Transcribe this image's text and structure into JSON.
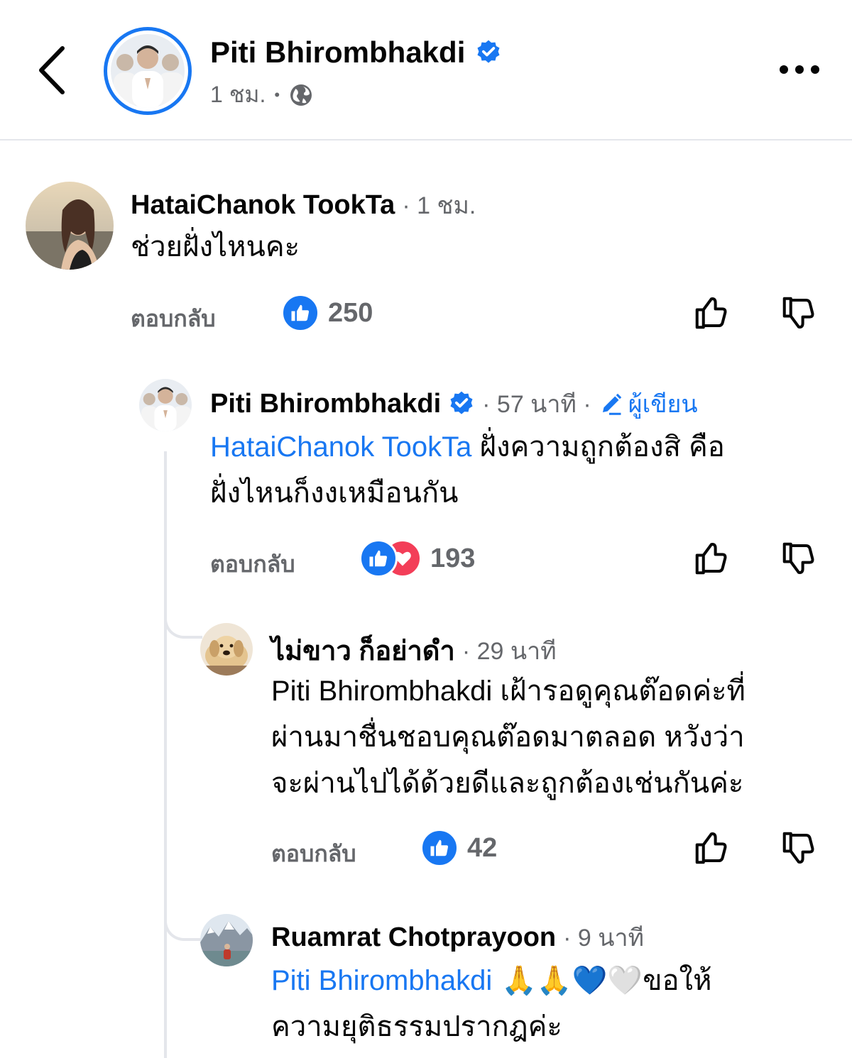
{
  "header": {
    "page_name": "Piti Bhirombhakdi",
    "time": "1 ชม.",
    "separator": "•"
  },
  "comments": [
    {
      "author": "HataiChanok TookTa",
      "meta": "· 1 ชม.",
      "text": "ช่วยฝั่งไหนคะ",
      "reply": "ตอบกลับ",
      "reaction_count": "250"
    },
    {
      "author": "Piti Bhirombhakdi",
      "meta": "· 57 นาที ·",
      "author_badge": "ผู้เขียน",
      "mention": "HataiChanok TookTa",
      "text_line1": " ฝั่งความถูกต้องสิ คือ",
      "text_line2": "ฝั่งไหนก็งงเหมือนกัน",
      "reply": "ตอบกลับ",
      "reaction_count": "193"
    },
    {
      "author": "ไม่ขาว ก็อย่าดำ",
      "meta": "· 29 นาที",
      "text_line1": "Piti Bhirombhakdi เฝ้ารอดูคุณต๊อดค่ะที่",
      "text_line2": "ผ่านมาชื่นชอบคุณต๊อดมาตลอด  หวังว่า",
      "text_line3": "จะผ่านไปได้ด้วยดีและถูกต้องเช่นกันค่ะ",
      "reply": "ตอบกลับ",
      "reaction_count": "42"
    },
    {
      "author": "Ruamrat Chotprayoon",
      "meta": "· 9 นาที",
      "mention": "Piti Bhirombhakdi",
      "emojis": " 🙏🙏💙🤍",
      "text_line1_rest": "ขอให้",
      "text_line2": "ความยุติธรรมปรากฎค่ะ"
    }
  ],
  "colors": {
    "accent": "#1877f2",
    "secondary_text": "#65676b",
    "love": "#f33e58",
    "divider": "#e4e6eb"
  },
  "icons": [
    "back-chevron-icon",
    "verified-badge-icon",
    "globe-icon",
    "more-dots-icon",
    "like-reaction-icon",
    "love-reaction-icon",
    "thumbs-up-outline-icon",
    "thumbs-down-outline-icon",
    "pencil-icon"
  ]
}
